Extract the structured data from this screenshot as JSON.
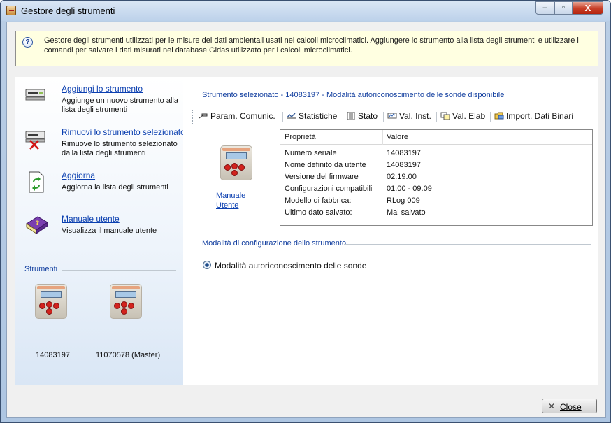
{
  "window": {
    "title": "Gestore degli strumenti",
    "minimize_glyph": "–",
    "maximize_glyph": "▫",
    "close_glyph": "X"
  },
  "info": {
    "icon_glyph": "?",
    "text": "Gestore degli strumenti utilizzati per le misure dei dati ambientali usati nei calcoli microclimatici. Aggiungere lo strumento alla lista degli strumenti e utilizzare i comandi per salvare i dati misurati nel database Gidas utilizzato per i calcoli microclimatici."
  },
  "tasks": [
    {
      "icon": "add-instrument-icon",
      "title": "Aggiungi lo strumento",
      "description": "Aggiunge un nuovo strumento alla lista degli strumenti"
    },
    {
      "icon": "remove-instrument-icon",
      "title": "Rimuovi lo strumento selezionato",
      "description": "Rimuove lo strumento selezionato dalla lista degli strumenti"
    },
    {
      "icon": "refresh-icon",
      "title": "Aggiorna",
      "description": "Aggiorna la lista degli strumenti"
    },
    {
      "icon": "manual-book-icon",
      "title": "Manuale utente",
      "description": "Visualizza il manuale utente"
    }
  ],
  "instruments": {
    "section_title": "Strumenti",
    "items": [
      {
        "label": "14083197"
      },
      {
        "label": "11070578 (Master)"
      }
    ]
  },
  "selected": {
    "heading": "Strumento selezionato  - 14083197 - Modalità autoriconoscimento delle sonde disponibile",
    "manual_link_line1": "Manuale",
    "manual_link_line2": "Utente"
  },
  "toolbar": {
    "items": [
      {
        "label": "Param. Comunic.",
        "icon": "communication-params-icon"
      },
      {
        "label": "Statistiche",
        "icon": "statistics-icon"
      },
      {
        "label": "Stato",
        "icon": "status-icon"
      },
      {
        "label": "Val. Inst.",
        "icon": "instant-values-icon"
      },
      {
        "label": "Val. Elab",
        "icon": "processed-values-icon"
      },
      {
        "label": "Import. Dati Binari",
        "icon": "import-binary-icon"
      }
    ]
  },
  "properties": {
    "col_property": "Proprietà",
    "col_value": "Valore",
    "rows": [
      {
        "name": "Numero seriale",
        "value": "14083197"
      },
      {
        "name": "Nome definito da utente",
        "value": "14083197"
      },
      {
        "name": "Versione del firmware",
        "value": "02.19.00"
      },
      {
        "name": "Configurazioni compatibili",
        "value": "01.00 - 09.09"
      },
      {
        "name": "Modello di fabbrica:",
        "value": "RLog 009"
      },
      {
        "name": "Ultimo dato salvato:",
        "value": "Mai salvato"
      }
    ]
  },
  "config": {
    "section_title": "Modalità di configurazione dello strumento",
    "option_label": "Modalità autoriconoscimento delle sonde",
    "option_selected": true
  },
  "footer": {
    "close_glyph": "✕",
    "close_label": "Close"
  },
  "colors": {
    "link": "#0b3fb0",
    "section_title": "#1440a0",
    "info_background": "#ffffe1",
    "device_key": "#d2231d"
  }
}
